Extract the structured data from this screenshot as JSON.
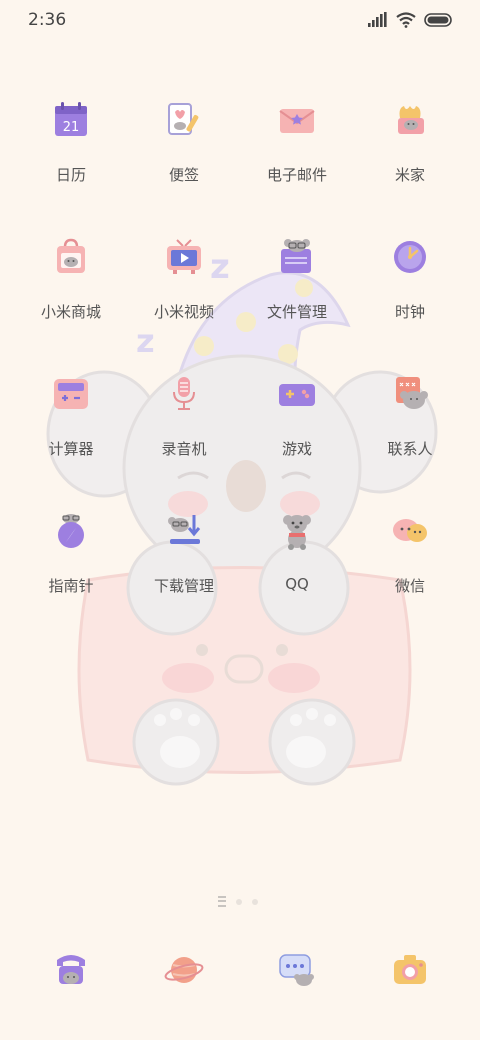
{
  "status_bar": {
    "time": "2:36",
    "icons": [
      "signal-icon",
      "wifi-icon",
      "battery-icon"
    ]
  },
  "apps": [
    {
      "label": "日历",
      "icon": "calendar-icon",
      "badge_text": "21"
    },
    {
      "label": "便签",
      "icon": "notes-icon"
    },
    {
      "label": "电子邮件",
      "icon": "email-icon"
    },
    {
      "label": "米家",
      "icon": "mijia-icon"
    },
    {
      "label": "小米商城",
      "icon": "store-icon"
    },
    {
      "label": "小米视频",
      "icon": "video-icon"
    },
    {
      "label": "文件管理",
      "icon": "file-manager-icon"
    },
    {
      "label": "时钟",
      "icon": "clock-icon"
    },
    {
      "label": "计算器",
      "icon": "calculator-icon"
    },
    {
      "label": "录音机",
      "icon": "recorder-icon"
    },
    {
      "label": "游戏",
      "icon": "game-icon"
    },
    {
      "label": "联系人",
      "icon": "contacts-icon"
    },
    {
      "label": "指南针",
      "icon": "compass-icon"
    },
    {
      "label": "下载管理",
      "icon": "download-icon"
    },
    {
      "label": "QQ",
      "icon": "qq-icon"
    },
    {
      "label": "微信",
      "icon": "wechat-icon"
    }
  ],
  "dock": [
    {
      "icon": "phone-icon"
    },
    {
      "icon": "browser-icon"
    },
    {
      "icon": "messages-icon"
    },
    {
      "icon": "camera-icon"
    }
  ],
  "pager": {
    "pages": 3,
    "current": 1
  },
  "colors": {
    "background": "#fdf6ee",
    "purple": "#9d7fe0",
    "pink": "#f2a0a8",
    "koala_gray": "#a9a4a6"
  }
}
